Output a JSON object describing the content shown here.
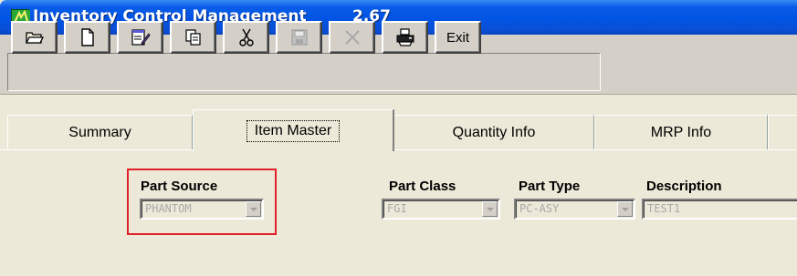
{
  "window": {
    "title": "Inventory Control Management",
    "version": "2.67"
  },
  "toolbar": {
    "buttons": [
      {
        "name": "open",
        "icon": "open-folder-icon",
        "enabled": true
      },
      {
        "name": "new",
        "icon": "new-document-icon",
        "enabled": true
      },
      {
        "name": "edit",
        "icon": "edit-pencil-icon",
        "enabled": true
      },
      {
        "name": "copy",
        "icon": "copy-icon",
        "enabled": true
      },
      {
        "name": "cut",
        "icon": "scissors-icon",
        "enabled": true
      },
      {
        "name": "save",
        "icon": "save-disk-icon",
        "enabled": false
      },
      {
        "name": "delete",
        "icon": "delete-x-icon",
        "enabled": false
      },
      {
        "name": "print",
        "icon": "printer-icon",
        "enabled": true
      }
    ],
    "exit_label": "Exit"
  },
  "tabs": [
    {
      "label": "Summary",
      "active": false
    },
    {
      "label": "Item Master",
      "active": true
    },
    {
      "label": "Quantity Info",
      "active": false
    },
    {
      "label": "MRP Info",
      "active": false
    }
  ],
  "fields": {
    "part_source": {
      "label": "Part Source",
      "value": "PHANTOM"
    },
    "part_class": {
      "label": "Part Class",
      "value": "FGI"
    },
    "part_type": {
      "label": "Part Type",
      "value": "PC-ASY"
    },
    "description": {
      "label": "Description",
      "value": "TEST1"
    }
  },
  "colors": {
    "titlebar": "#0054e3",
    "highlight": "#e0202a",
    "disabled_text": "#a9a9a9"
  }
}
